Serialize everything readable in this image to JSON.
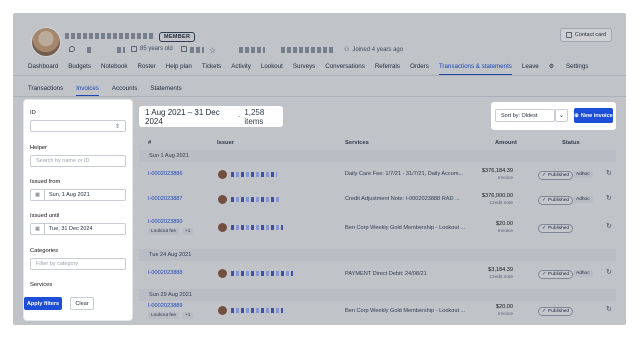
{
  "header": {
    "member_badge": "MEMBER",
    "age": "85 years old",
    "joined": "Joined 4 years ago",
    "contact_card_label": "Contact card"
  },
  "tabs": [
    "Dashboard",
    "Budgets",
    "Notebook",
    "Roster",
    "Help plan",
    "Tickets",
    "Activity",
    "Lookout",
    "Surveys",
    "Conversations",
    "Referrals",
    "Orders",
    "Transactions & statements",
    "Leave",
    "Settings"
  ],
  "active_tab": "Transactions & statements",
  "subtabs": [
    "Transactions",
    "Invoices",
    "Accounts",
    "Statements"
  ],
  "filters": {
    "id_label": "ID",
    "helper_label": "Helper",
    "helper_placeholder": "Search by name or ID",
    "issued_from_label": "Issued from",
    "issued_from_value": "Sun, 1 Aug 2021",
    "issued_until_label": "Issued until",
    "issued_until_value": "Tue, 31 Dec 2024",
    "categories_label": "Categories",
    "categories_placeholder": "Filter by category",
    "services_label": "Services",
    "apply_label": "Apply filters",
    "clear_label": "Clear"
  },
  "list": {
    "date_range": "1 Aug 2021 – 31 Dec 2024",
    "item_count": "1,258 items",
    "sort_value": "Sort by: Oldest",
    "new_invoice_label": "New invoice",
    "columns": [
      "#",
      "Issuer",
      "Services",
      "Amount",
      "Status"
    ],
    "groups": [
      {
        "date": "Sun 1 Aug 2021",
        "rows": [
          {
            "number": "I-0002023886",
            "tag": "",
            "service": "Daily Care Fee: 1/7/21 - 31/7/21, Daily Accom...",
            "amount": "$376,184.39",
            "kind": "Invoice",
            "status": "Published",
            "adhoc": "Adhoc"
          },
          {
            "number": "I-0002023887",
            "tag": "",
            "service": "Credit Adjustment Note: I-0002023888 RAD ...",
            "amount": "$376,000.00",
            "kind": "Credit note",
            "status": "Published",
            "adhoc": "Adhoc"
          },
          {
            "number": "I-0002023890",
            "tag": "Lookout fee",
            "service": "Ben Corp Weekly Gold Membership - Lookout ...",
            "amount": "$20.00",
            "kind": "Invoice",
            "status": "Published",
            "adhoc": ""
          }
        ]
      },
      {
        "date": "Tue 24 Aug 2021",
        "rows": [
          {
            "number": "I-0002023888",
            "tag": "",
            "service": "PAYMENT Direct Debit: 24/08/21",
            "amount": "$3,184.39",
            "kind": "Credit note",
            "status": "Published",
            "adhoc": "Adhoc"
          }
        ]
      },
      {
        "date": "Sun 29 Aug 2021",
        "rows": [
          {
            "number": "I-0002023889",
            "tag": "Lookout fee",
            "service": "Ben Corp Weekly Gold Membership - Lookout ...",
            "amount": "$20.00",
            "kind": "Invoice",
            "status": "Published",
            "adhoc": ""
          }
        ]
      }
    ],
    "tag_more": "+1"
  },
  "colors": {
    "accent": "#1d4ed8",
    "overlay": "rgba(30,40,55,0.22)"
  }
}
